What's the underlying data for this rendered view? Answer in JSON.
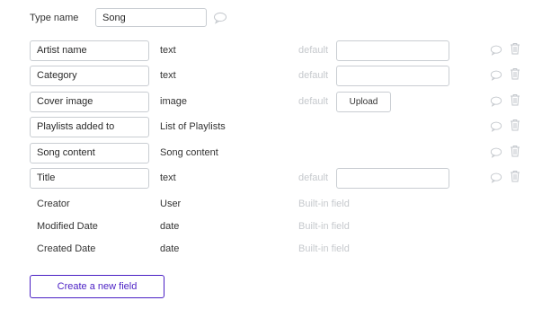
{
  "header": {
    "type_name_label": "Type name",
    "type_name_value": "Song"
  },
  "fields": [
    {
      "name": "Artist name",
      "type": "text",
      "default_label": "default",
      "default_kind": "input",
      "default_value": ""
    },
    {
      "name": "Category",
      "type": "text",
      "default_label": "default",
      "default_kind": "input",
      "default_value": ""
    },
    {
      "name": "Cover image",
      "type": "image",
      "default_label": "default",
      "default_kind": "upload",
      "upload_label": "Upload"
    },
    {
      "name": "Playlists added to",
      "type": "List of Playlists",
      "default_kind": "none"
    },
    {
      "name": "Song content",
      "type": "Song content",
      "default_kind": "none"
    },
    {
      "name": "Title",
      "type": "text",
      "default_label": "default",
      "default_kind": "input",
      "default_value": ""
    }
  ],
  "builtin_fields": [
    {
      "name": "Creator",
      "type": "User",
      "note": "Built-in field"
    },
    {
      "name": "Modified Date",
      "type": "date",
      "note": "Built-in field"
    },
    {
      "name": "Created Date",
      "type": "date",
      "note": "Built-in field"
    }
  ],
  "actions": {
    "create_new_field_label": "Create a new field"
  },
  "icons": {
    "comment": "comment-icon",
    "trash": "trash-icon"
  },
  "colors": {
    "accent": "#4a1fc4",
    "muted": "#c6c9cd",
    "border": "#c9cdd2"
  }
}
